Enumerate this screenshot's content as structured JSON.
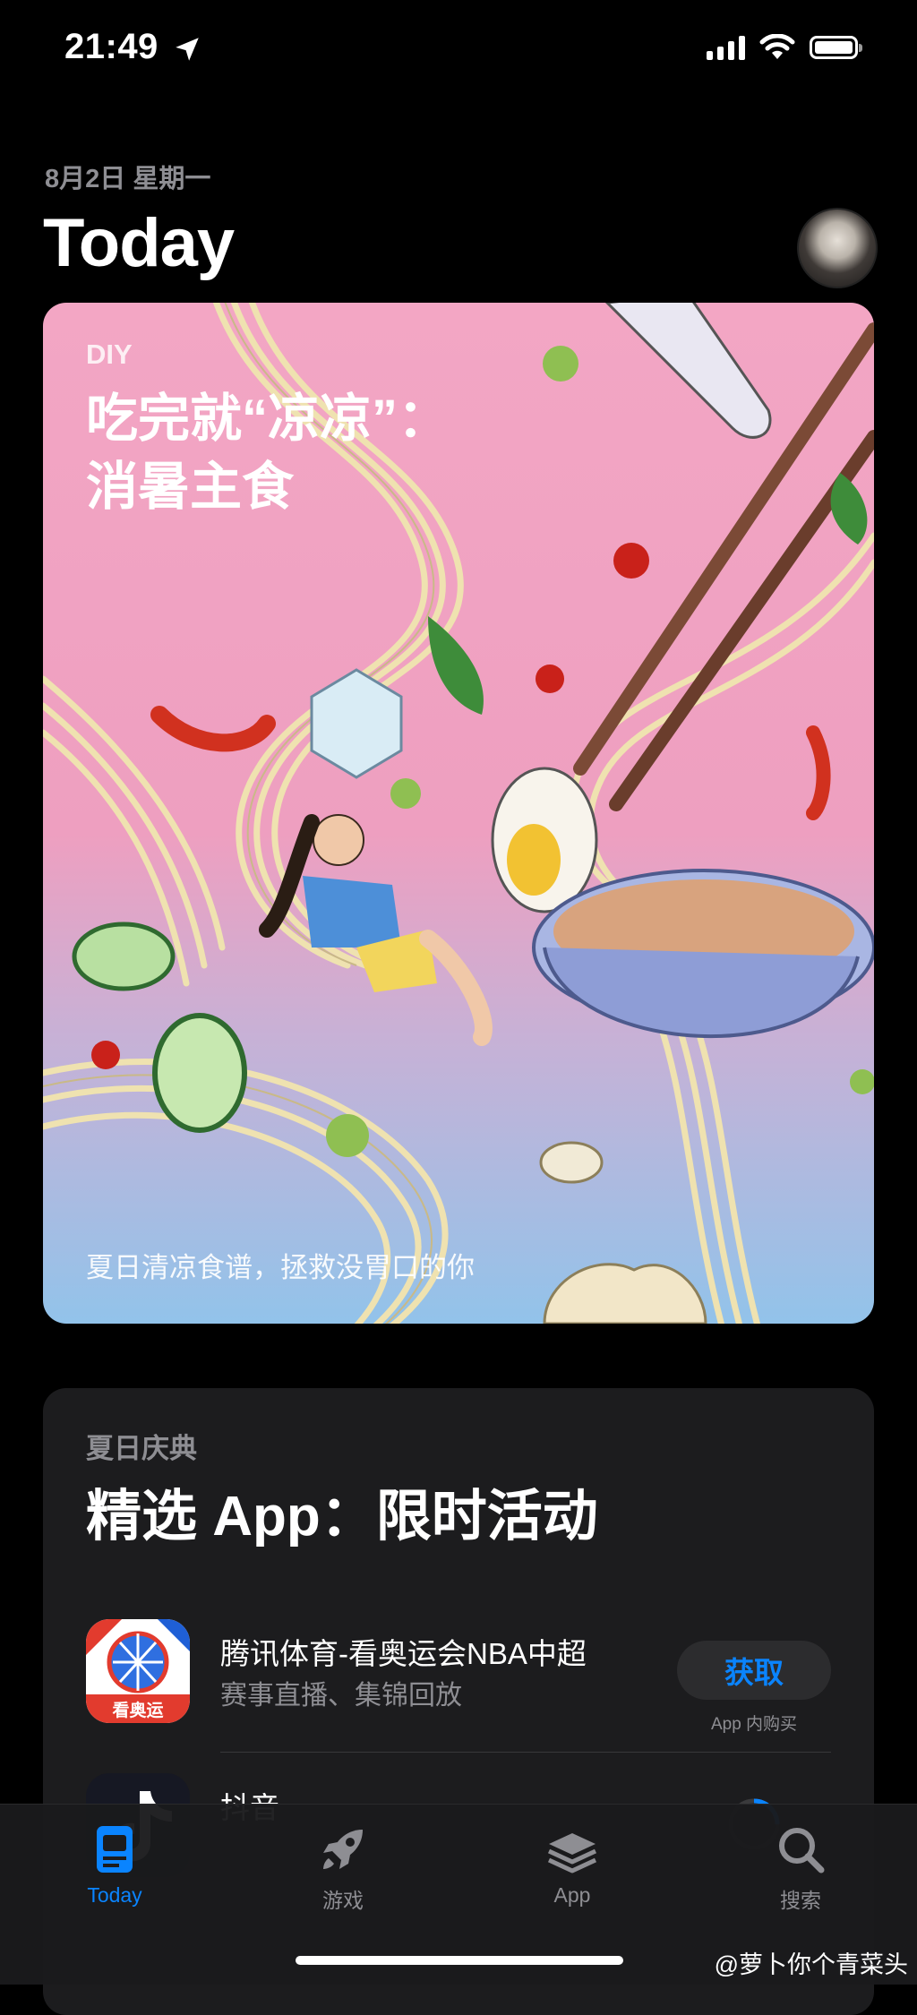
{
  "status": {
    "time": "21:49"
  },
  "header": {
    "date": "8月2日 星期一",
    "title": "Today"
  },
  "hero_card": {
    "tag": "DIY",
    "title_line1": "吃完就“凉凉”：",
    "title_line2": "消暑主食",
    "subtitle": "夏日清凉食谱，拯救没胃口的你"
  },
  "feature_card": {
    "tag": "夏日庆典",
    "title": "精选 App：限时活动",
    "apps": [
      {
        "name": "腾讯体育-看奥运会NBA中超",
        "desc": "赛事直播、集锦回放",
        "button": "获取",
        "note": "App 内购买",
        "icon_text": "看奥运"
      },
      {
        "name": "抖音"
      }
    ]
  },
  "tabbar": {
    "tabs": [
      {
        "label": "Today",
        "icon": "today-icon",
        "active": true
      },
      {
        "label": "游戏",
        "icon": "rocket-icon"
      },
      {
        "label": "App",
        "icon": "layers-icon"
      },
      {
        "label": "搜索",
        "icon": "search-icon"
      }
    ]
  },
  "watermark": "@萝卜你个青菜头",
  "colors": {
    "accent": "#0a84ff",
    "card_bg": "#1c1c1e",
    "hero_pink": "#f3a6c4",
    "hero_blue": "#92c3ea"
  }
}
